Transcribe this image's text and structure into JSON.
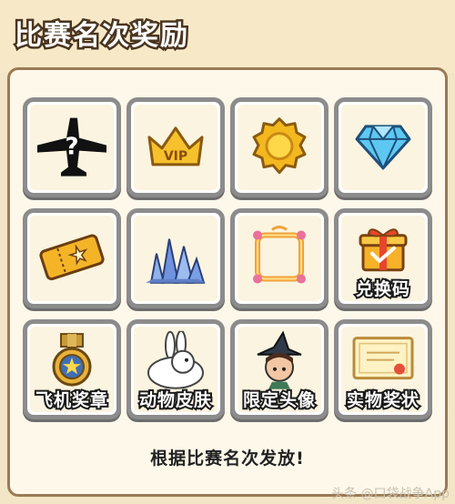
{
  "header": {
    "title": "比赛名次奖励"
  },
  "rewards": [
    {
      "icon": "mystery-plane-icon",
      "label": ""
    },
    {
      "icon": "vip-crown-icon",
      "label": "",
      "badge_text": "VIP"
    },
    {
      "icon": "gold-coin-icon",
      "label": ""
    },
    {
      "icon": "diamond-icon",
      "label": ""
    },
    {
      "icon": "ticket-icon",
      "label": ""
    },
    {
      "icon": "crystal-cluster-icon",
      "label": ""
    },
    {
      "icon": "avatar-frame-icon",
      "label": ""
    },
    {
      "icon": "gift-box-icon",
      "label": "兑换码"
    },
    {
      "icon": "medal-icon",
      "label": "飞机奖章"
    },
    {
      "icon": "rabbit-icon",
      "label": "动物皮肤"
    },
    {
      "icon": "witch-avatar-icon",
      "label": "限定头像"
    },
    {
      "icon": "certificate-icon",
      "label": "实物奖状"
    }
  ],
  "footer": {
    "note": "根据比赛名次发放!"
  },
  "watermark": "头条 @口袋战争App",
  "colors": {
    "background": "#f3e6c6",
    "panel": "#fdf8ea",
    "tile_border": "#8c8c8c",
    "panel_border": "#9a7a54"
  }
}
